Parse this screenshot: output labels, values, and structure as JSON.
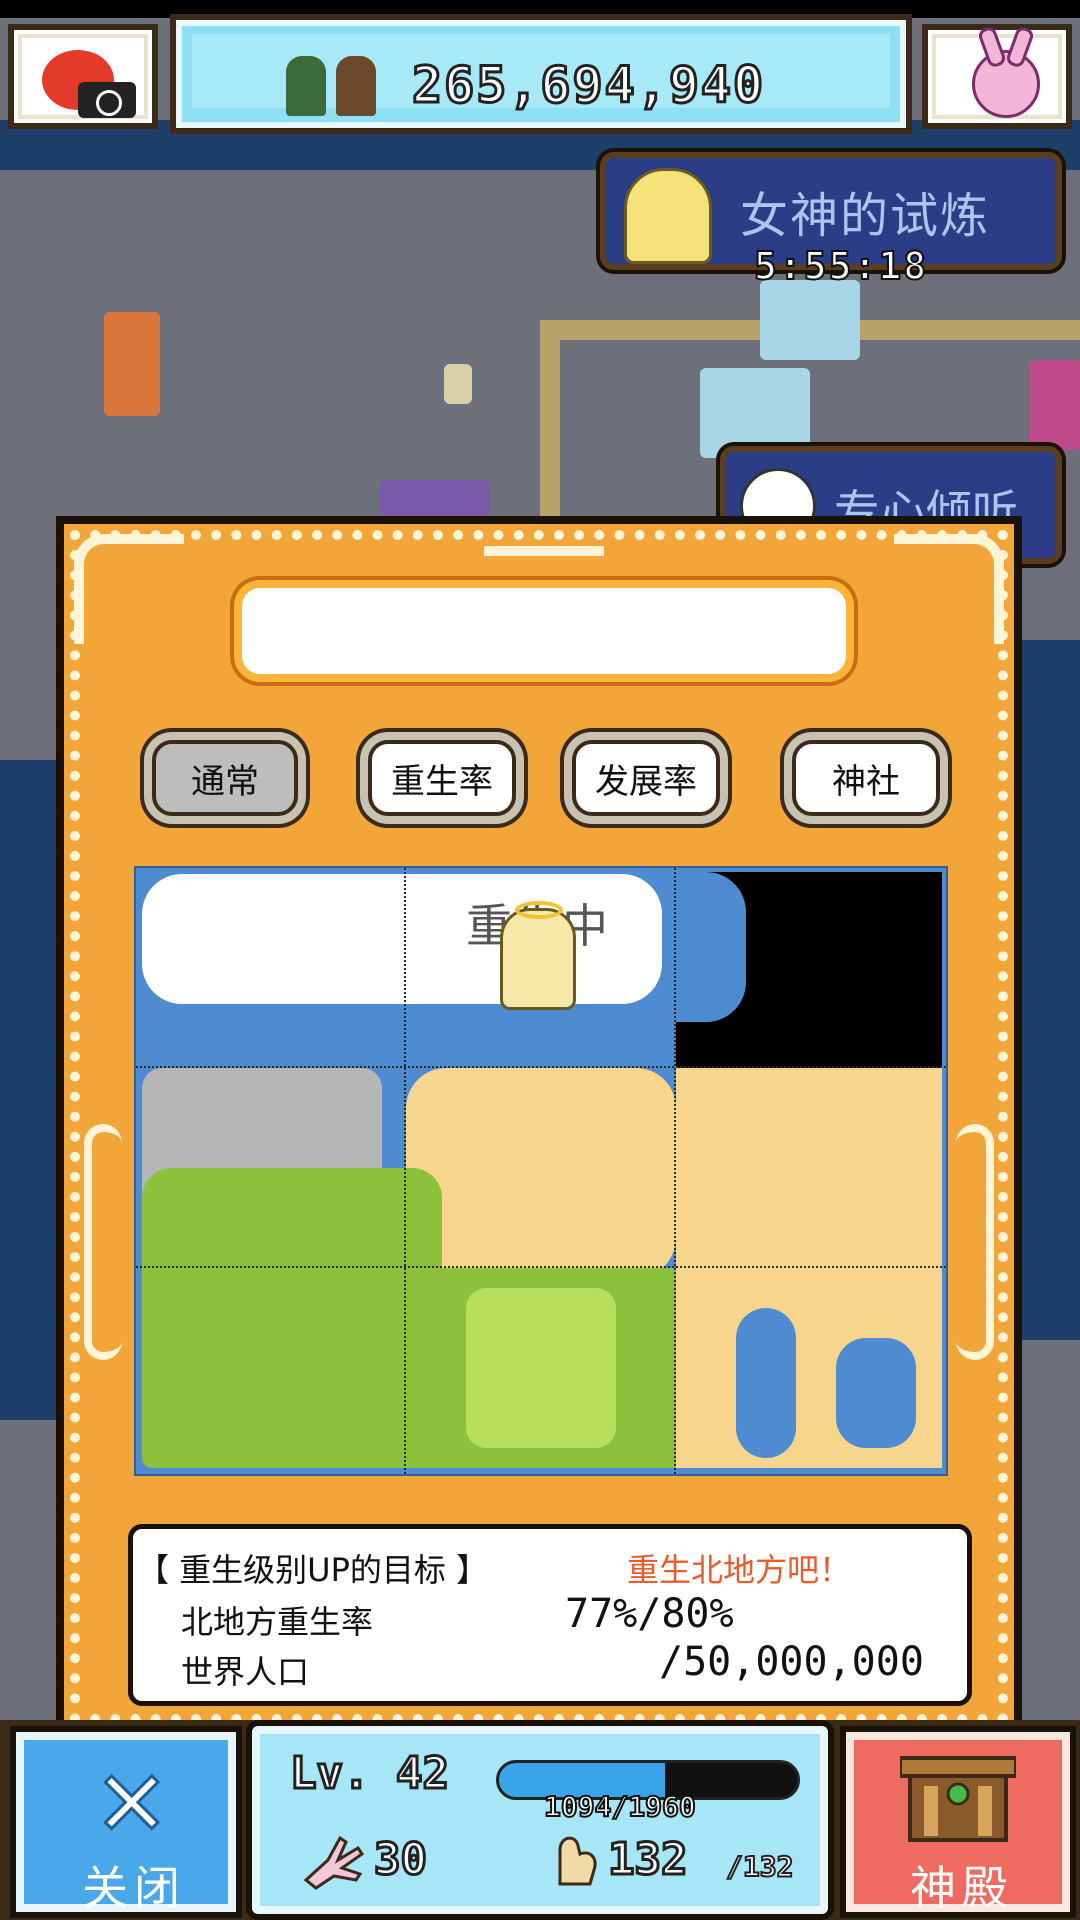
{
  "header": {
    "money": "265,694,940"
  },
  "events": {
    "trial_title": "女神的试炼",
    "trial_timer": "5:55:18",
    "listen_title": "专心倾听"
  },
  "dialog": {
    "name_value": "",
    "tabs": [
      {
        "label": "通常",
        "active": true
      },
      {
        "label": "重生率",
        "active": false
      },
      {
        "label": "发展率",
        "active": false
      },
      {
        "label": "神社",
        "active": false
      }
    ],
    "map_label": "重生中",
    "goal": {
      "title": "【 重生级别UP的目标 】",
      "hint": "重生北地方吧！",
      "rows": [
        {
          "label": "北地方重生率",
          "value": "77%/80%"
        },
        {
          "label": "世界人口",
          "value": "/50,000,000"
        }
      ]
    }
  },
  "bottom": {
    "close_label": "关闭",
    "level": "Lv. 42",
    "xp_text": "1094/1960",
    "xp_fraction": 0.558,
    "hand_value": "30",
    "power_value": "132",
    "power_max": "/132",
    "temple_label": "神殿"
  },
  "colors": {
    "dialog_bg": "#f2a63a",
    "map_water": "#4f8bd1",
    "goal_hint": "#ec5a2a",
    "close_btn": "#49a7ea",
    "temple_btn": "#ef6b5f"
  }
}
